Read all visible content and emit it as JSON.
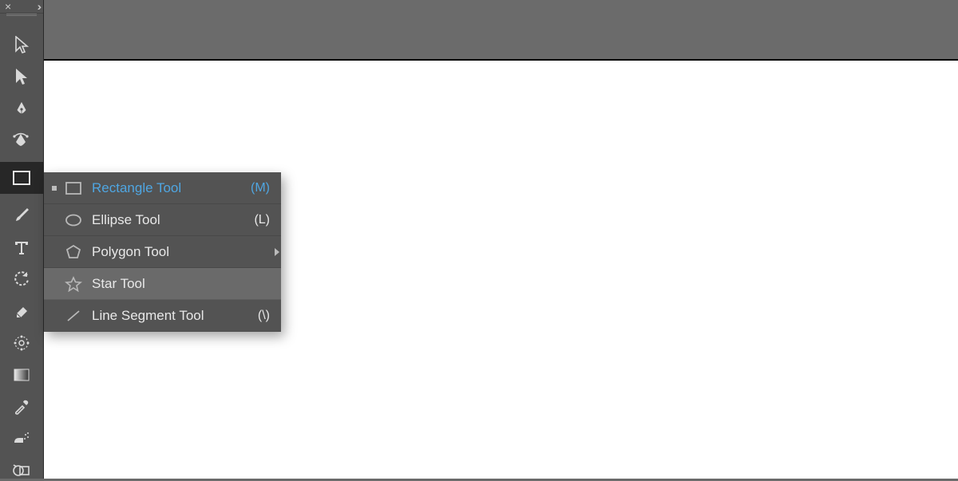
{
  "panel_header": {
    "close": "×",
    "expand": "››"
  },
  "tools": [
    {
      "name": "selection-tool"
    },
    {
      "name": "direct-selection-tool"
    },
    {
      "name": "pen-tool"
    },
    {
      "name": "curvature-tool"
    },
    {
      "name": "rectangle-tool",
      "selected": true
    },
    {
      "name": "paintbrush-tool"
    },
    {
      "name": "type-tool"
    },
    {
      "name": "rotate-tool"
    },
    {
      "name": "eraser-tool"
    },
    {
      "name": "scale-tool"
    },
    {
      "name": "gradient-tool"
    },
    {
      "name": "eyedropper-tool"
    },
    {
      "name": "symbol-sprayer-tool"
    },
    {
      "name": "shape-builder-tool"
    }
  ],
  "shape_flyout": {
    "items": [
      {
        "name": "rectangle-tool",
        "label": "Rectangle Tool",
        "shortcut": "(M)",
        "active": true
      },
      {
        "name": "ellipse-tool",
        "label": "Ellipse Tool",
        "shortcut": "(L)"
      },
      {
        "name": "polygon-tool",
        "label": "Polygon Tool",
        "has_submenu": true
      },
      {
        "name": "star-tool",
        "label": "Star Tool",
        "hover": true
      },
      {
        "name": "line-segment-tool",
        "label": "Line Segment Tool",
        "shortcut": "(\\)"
      }
    ]
  }
}
